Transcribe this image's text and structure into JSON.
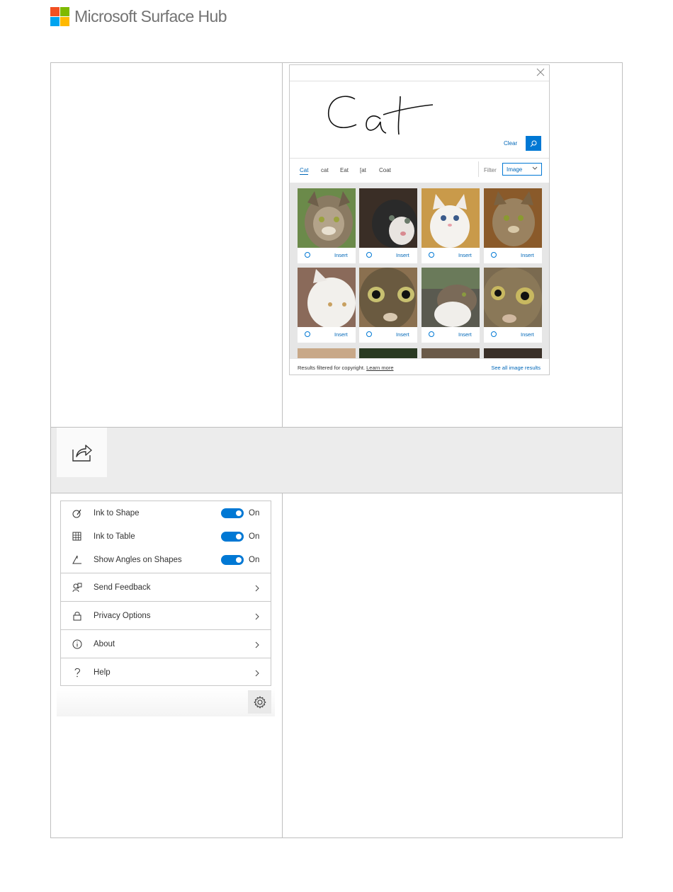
{
  "header": {
    "brand": "Microsoft Surface Hub",
    "logo_colors": [
      "#f25022",
      "#7fba00",
      "#00a4ef",
      "#ffb900"
    ]
  },
  "search_panel": {
    "ink_text": "Cat",
    "clear_label": "Clear",
    "suggestions": [
      "Cat",
      "cat",
      "Eat",
      "[at",
      "Coat"
    ],
    "active_suggestion": "Cat",
    "filter_label": "Filter",
    "filter_value": "Image",
    "insert_label": "Insert",
    "footer_text": "Results filtered for copyright.",
    "learn_more": "Learn more",
    "see_all": "See all image results",
    "accent": "#0078d4"
  },
  "settings": {
    "toggles": [
      {
        "label": "Ink to Shape",
        "state": "On",
        "icon": "ink-shape-icon"
      },
      {
        "label": "Ink to Table",
        "state": "On",
        "icon": "ink-table-icon"
      },
      {
        "label": "Show Angles on Shapes",
        "state": "On",
        "icon": "angle-icon"
      }
    ],
    "links": [
      {
        "label": "Send Feedback",
        "icon": "feedback-icon"
      },
      {
        "label": "Privacy Options",
        "icon": "lock-icon"
      },
      {
        "label": "About",
        "icon": "info-icon"
      },
      {
        "label": "Help",
        "icon": "help-icon"
      }
    ]
  }
}
